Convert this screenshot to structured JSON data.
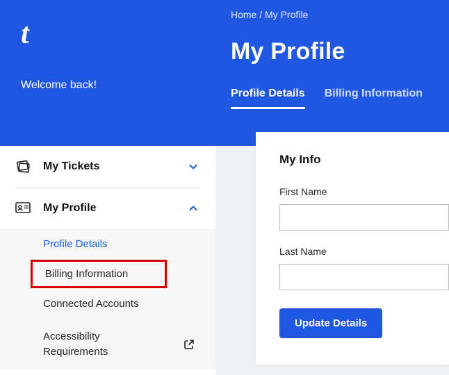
{
  "brand": {
    "logo_letter": "t"
  },
  "sidebar": {
    "welcome": "Welcome back!",
    "items": [
      {
        "label": "My Tickets",
        "expanded": false
      },
      {
        "label": "My Profile",
        "expanded": true
      }
    ],
    "profile_children": [
      {
        "label": "Profile Details"
      },
      {
        "label": "Billing Information"
      },
      {
        "label": "Connected Accounts"
      },
      {
        "label": "Accessibility Requirements"
      }
    ]
  },
  "header": {
    "breadcrumb": "Home / My Profile",
    "title": "My Profile",
    "tabs": [
      {
        "label": "Profile Details"
      },
      {
        "label": "Billing Information"
      }
    ]
  },
  "card": {
    "title": "My Info",
    "first_name_label": "First Name",
    "first_name_value": "",
    "last_name_label": "Last Name",
    "last_name_value": "",
    "update_btn": "Update Details"
  },
  "colors": {
    "primary": "#1f57e0",
    "highlight_border": "#d40000"
  }
}
